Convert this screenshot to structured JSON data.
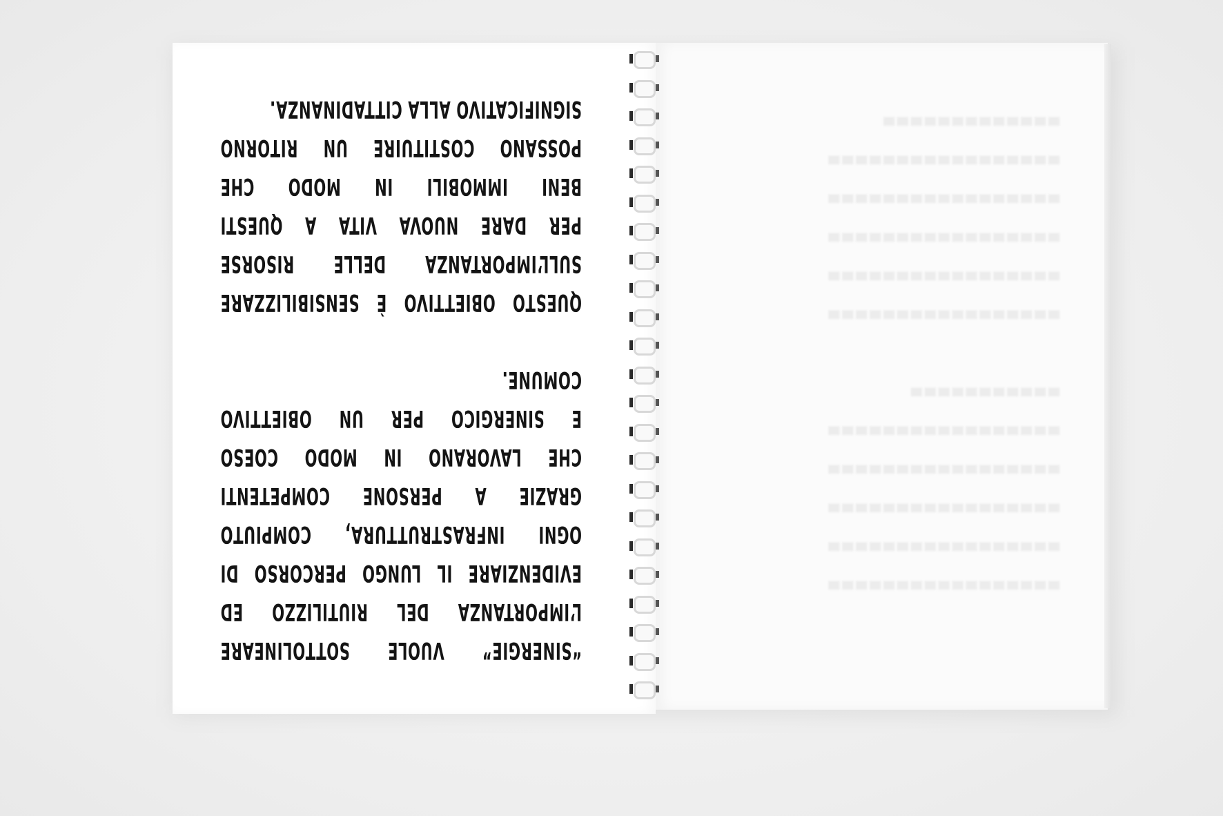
{
  "left_page": {
    "paragraph_1": [
      "“SINERGIE” VUOLE SOTTOLINEARE",
      "L’IMPORTANZA DEL RIUTILIZZO ED",
      "EVIDENZIARE IL LUNGO PERCORSO DI",
      "OGNI INFRASTRUTTURA, COMPIUTO",
      "GRAZIE A PERSONE COMPETENTI",
      "CHE LAVORANO IN MODO COESO",
      "E SINERGICO PER UN OBIETTIVO",
      "COMUNE."
    ],
    "paragraph_2": [
      "QUESTO OBIETTIVO È SENSIBILIZZARE",
      "SULL’IMPORTANZA DELLE RISORSE",
      "PER DARE NUOVA VITA A QUESTI",
      "BENI IMMOBILI IN MODO CHE",
      "POSSANO COSTITUIRE UN RITORNO",
      "SIGNIFICATIVO ALLA CITTADINANZA."
    ]
  },
  "colors": {
    "text": "#141414",
    "paper": "#ffffff",
    "background": "#eeeeee"
  }
}
